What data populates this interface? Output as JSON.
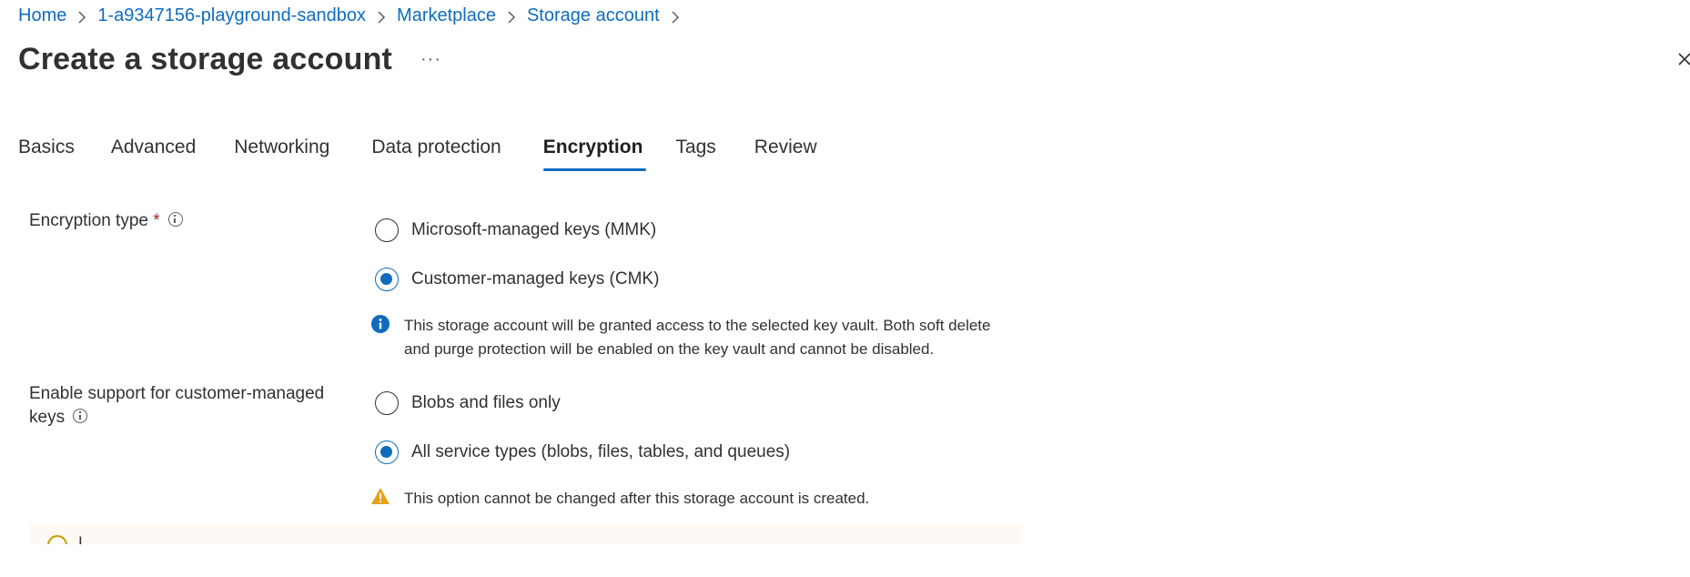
{
  "breadcrumb": {
    "items": [
      "Home",
      "1-a9347156-playground-sandbox",
      "Marketplace",
      "Storage account"
    ]
  },
  "header": {
    "title": "Create a storage account",
    "more_label": "···"
  },
  "tabs": [
    {
      "label": "Basics",
      "active": false
    },
    {
      "label": "Advanced",
      "active": false
    },
    {
      "label": "Networking",
      "active": false
    },
    {
      "label": "Data protection",
      "active": false
    },
    {
      "label": "Encryption",
      "active": true
    },
    {
      "label": "Tags",
      "active": false
    },
    {
      "label": "Review",
      "active": false
    }
  ],
  "form": {
    "encryption_type": {
      "label": "Encryption type",
      "required_mark": "*",
      "options": [
        {
          "label": "Microsoft-managed keys (MMK)",
          "checked": false
        },
        {
          "label": "Customer-managed keys (CMK)",
          "checked": true
        }
      ],
      "info_message_line1": "This storage account will be granted access to the selected key vault. Both soft delete",
      "info_message_line2": "and purge protection will be enabled on the key vault and cannot be disabled."
    },
    "cmk_support": {
      "label_line1": "Enable support for customer-managed",
      "label_line2": "keys",
      "options": [
        {
          "label": "Blobs and files only",
          "checked": false
        },
        {
          "label": "All service types (blobs, files, tables, and queues)",
          "checked": true
        }
      ],
      "warning_message": "This option cannot be changed after this storage account is created."
    },
    "banner_text": "I                                                                                                              "
  },
  "colors": {
    "link": "#0f6cbd",
    "accent": "#0f6cbd",
    "warning": "#e8a21a",
    "required": "#a4262c",
    "banner_bg": "#fff9f5"
  },
  "icons": {
    "breadcrumb_separator": "chevron-right-icon",
    "close": "close-icon",
    "info": "info-icon",
    "info_filled": "info-filled-icon",
    "warning": "warning-triangle-icon"
  }
}
